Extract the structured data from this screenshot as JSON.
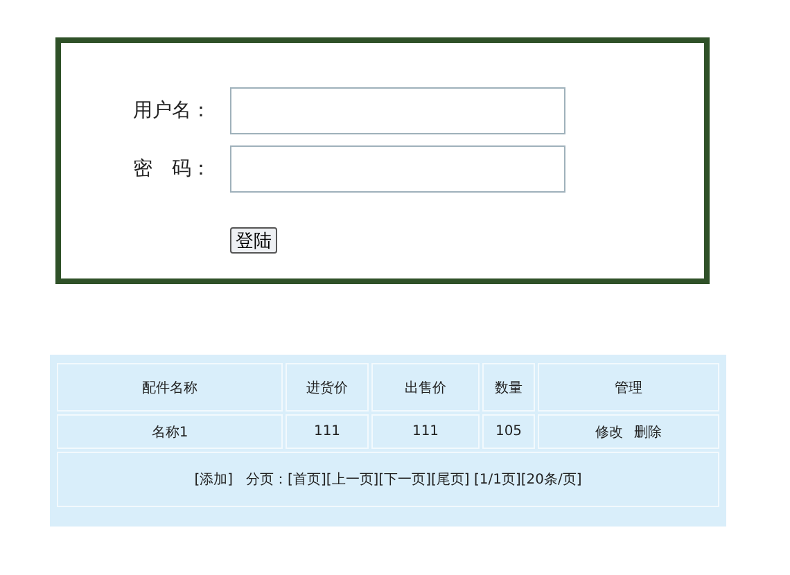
{
  "login": {
    "fields": [
      {
        "label": "用户名："
      },
      {
        "label": "密　码："
      }
    ],
    "button": "登陆"
  },
  "table": {
    "columns": [
      "配件名称",
      "进货价",
      "出售价",
      "数量",
      "管理"
    ],
    "rows": [
      {
        "cells": [
          "名称1",
          "111",
          "111",
          "105"
        ],
        "actions": [
          "修改",
          "删除"
        ]
      }
    ],
    "footer": {
      "add": "[添加]",
      "paging_label": "分页：",
      "links": [
        "[首页]",
        "[上一页]",
        "[下一页]",
        "[尾页]"
      ],
      "page_info": "[1/1页]",
      "page_size": "[20条/页]"
    }
  }
}
